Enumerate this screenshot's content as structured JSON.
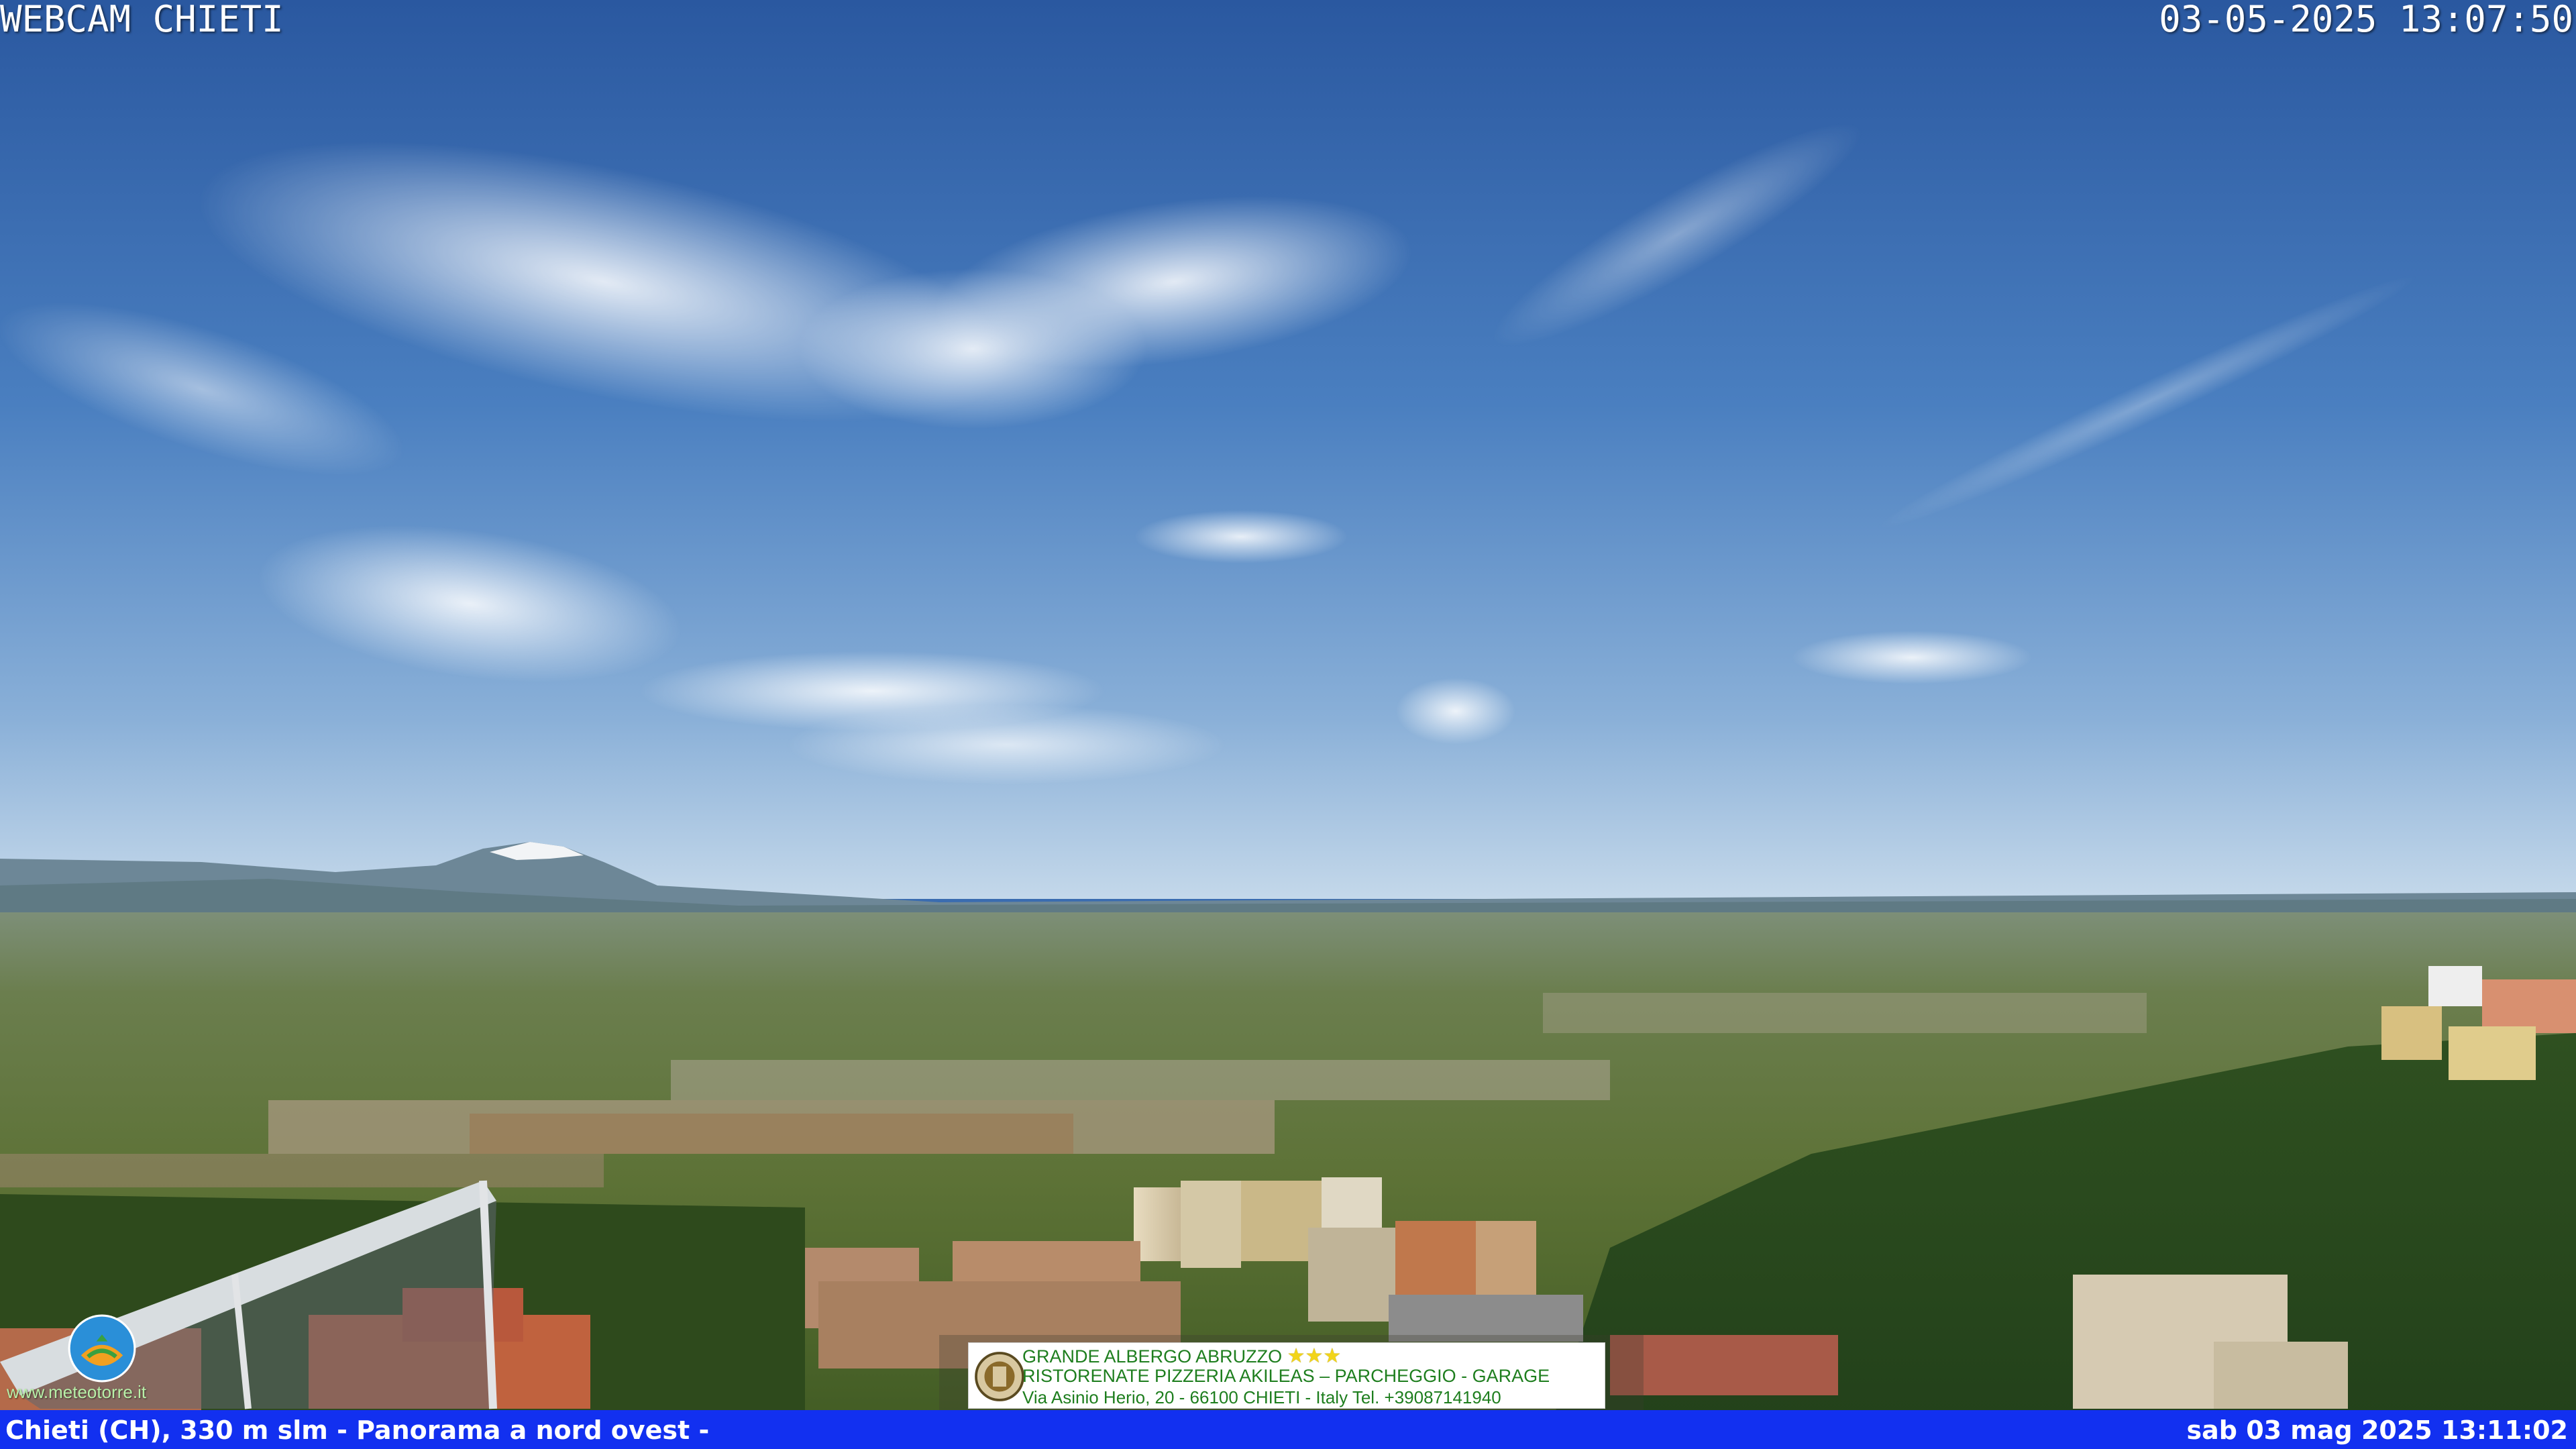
{
  "webcam": {
    "title": "WEBCAM CHIETI",
    "timestamp": "03-05-2025 13:07:50"
  },
  "footer": {
    "location": "Chieti (CH), 330 m slm - Panorama a nord ovest -",
    "datetime": "sab 03 mag 2025 13:11:02"
  },
  "advert": {
    "line1": "GRANDE ALBERGO ABRUZZO",
    "stars": "★★★",
    "line2": "RISTORENATE PIZZERIA AKILEAS – PARCHEGGIO - GARAGE",
    "line3": "Via Asinio Herio, 20 - 66100 CHIETI - Italy Tel. +39087141940",
    "crest_icon": "hotel-crest-icon"
  },
  "watermark": {
    "url": "www.meteotorre.it",
    "logo_icon": "meteo-logo-icon"
  },
  "colors": {
    "sky_top": "#2f5fa6",
    "sky_horizon": "#bcd4ea",
    "footer_bar": "#1230f0",
    "ad_text": "#1e7e1e"
  }
}
